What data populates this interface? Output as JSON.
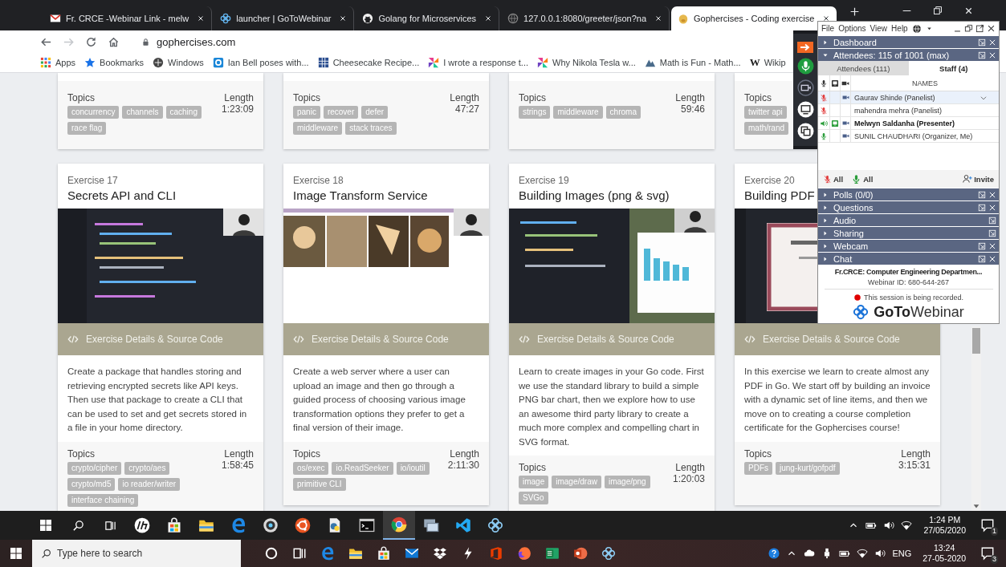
{
  "browser": {
    "tabs": [
      {
        "title": "Fr. CRCE -Webinar Link - melw",
        "kind": "mail",
        "selected": false
      },
      {
        "title": "launcher | GoToWebinar",
        "kind": "flower",
        "selected": false
      },
      {
        "title": "Golang for Microservices",
        "kind": "octo",
        "selected": false
      },
      {
        "title": "127.0.0.1:8080/greeter/json?na",
        "kind": "globe",
        "selected": false
      },
      {
        "title": "Gophercises - Coding exercise",
        "kind": "blob",
        "selected": true
      }
    ],
    "address": {
      "url": "gophercises.com",
      "forward_disabled": true
    },
    "bookmarks": [
      {
        "label": "Apps",
        "kind": "apps"
      },
      {
        "label": "Bookmarks",
        "kind": "star"
      },
      {
        "label": "Windows",
        "kind": "round"
      },
      {
        "label": "Ian Bell poses with...",
        "kind": "square"
      },
      {
        "label": "Cheesecake Recipe...",
        "kind": "grid"
      },
      {
        "label": "I wrote a response t...",
        "kind": "pinwheel"
      },
      {
        "label": "Why Nikola Tesla w...",
        "kind": "pinwheel"
      },
      {
        "label": "Math is Fun - Math...",
        "kind": "peak"
      },
      {
        "label": "Wikip",
        "kind": "letter",
        "letter": "W"
      }
    ]
  },
  "content": {
    "top_cards": [
      {
        "topics_label": "Topics",
        "tags": [
          "concurrency",
          "channels",
          "caching",
          "race flag"
        ],
        "length_label": "Length",
        "length": "1:23:09"
      },
      {
        "topics_label": "Topics",
        "tags": [
          "panic",
          "recover",
          "defer",
          "middleware",
          "stack traces"
        ],
        "length_label": "Length",
        "length": "47:27"
      },
      {
        "topics_label": "Topics",
        "tags": [
          "strings",
          "middleware",
          "chroma"
        ],
        "length_label": "Length",
        "length": "59:46"
      },
      {
        "topics_label": "Topics",
        "tags": [
          "twitter api",
          "math/rand"
        ]
      }
    ],
    "cards": [
      {
        "exercise": "Exercise 17",
        "title": "Secrets API and CLI",
        "link": "Exercise Details & Source Code",
        "description": "Create a package that handles storing and retrieving encrypted secrets like API keys. Then use that package to create a CLI that can be used to set and get secrets stored in a file in your home directory.",
        "topics_label": "Topics",
        "tags": [
          "crypto/cipher",
          "crypto/aes",
          "crypto/md5",
          "io reader/writer",
          "interface chaining"
        ],
        "length_label": "Length",
        "length": "1:58:45"
      },
      {
        "exercise": "Exercise 18",
        "title": "Image Transform Service",
        "link": "Exercise Details & Source Code",
        "description": "Create a web server where a user can upload an image and then go through a guided process of choosing various image transformation options they prefer to get a final version of their image.",
        "topics_label": "Topics",
        "tags": [
          "os/exec",
          "io.ReadSeeker",
          "io/ioutil",
          "primitive CLI"
        ],
        "length_label": "Length",
        "length": "2:11:30"
      },
      {
        "exercise": "Exercise 19",
        "title": "Building Images (png & svg)",
        "link": "Exercise Details & Source Code",
        "description": "Learn to create images in your Go code. First we use the standard library to build a simple PNG bar chart, then we explore how to use an awesome third party library to create a much more complex and compelling chart in SVG format.",
        "topics_label": "Topics",
        "tags": [
          "image",
          "image/draw",
          "image/png",
          "SVGo"
        ],
        "length_label": "Length",
        "length": "1:20:03"
      },
      {
        "exercise": "Exercise 20",
        "title": "Building PDF",
        "link": "Exercise Details & Source Code",
        "description": "In this exercise we learn to create almost any PDF in Go. We start off by building an invoice with a dynamic set of line items, and then we move on to creating a course completion certificate for the Gophercises course!",
        "topics_label": "Topics",
        "tags": [
          "PDFs",
          "jung-kurt/gofpdf"
        ],
        "length_label": "Length",
        "length": "3:15:31"
      }
    ]
  },
  "webinar": {
    "menu": [
      "File",
      "Options",
      "View",
      "Help"
    ],
    "sections": [
      {
        "title": "Dashboard",
        "expanded": false,
        "closable": true
      },
      {
        "title": "Attendees: 115 of 1001 (max)",
        "expanded": true,
        "closable": true,
        "kind": "attendees"
      },
      {
        "title": "Polls (0/0)",
        "expanded": false,
        "closable": true
      },
      {
        "title": "Questions",
        "expanded": false,
        "closable": true
      },
      {
        "title": "Audio",
        "expanded": false,
        "closable": false
      },
      {
        "title": "Sharing",
        "expanded": false,
        "closable": false
      },
      {
        "title": "Webcam",
        "expanded": false,
        "closable": true
      },
      {
        "title": "Chat",
        "expanded": false,
        "closable": true
      }
    ],
    "attendee_tabs": [
      {
        "label": "Attendees (111)",
        "selected": false
      },
      {
        "label": "Staff (4)",
        "selected": true
      }
    ],
    "names_header": "NAMES",
    "people": [
      {
        "name": "Gaurav Shinde (Panelist)",
        "kind": "muted",
        "presenter": false,
        "camera": true,
        "selected": true
      },
      {
        "name": "mahendra mehra (Panelist)",
        "kind": "muted",
        "presenter": false,
        "camera": false,
        "selected": false
      },
      {
        "name": "Melwyn Saldanha (Presenter)",
        "kind": "speaking",
        "presenter": true,
        "camera": true,
        "selected": false
      },
      {
        "name": "SUNIL CHAUDHARI (Organizer, Me)",
        "kind": "unmuted",
        "presenter": false,
        "camera": true,
        "selected": false
      }
    ],
    "mute_all": "All",
    "unmute_all": "All",
    "invite": "Invite",
    "organizer": "Fr.CRCE: Computer Engineering Departmen...",
    "webinar_id": "Webinar ID: 680-644-267",
    "recording": "This session is being recorded.",
    "logo_bold": "GoTo",
    "logo_light": "Webinar"
  },
  "taskbar_inner": {
    "apps": [
      {
        "kind": "hp",
        "active": false
      },
      {
        "kind": "bag",
        "active": false
      },
      {
        "kind": "folder",
        "active": false
      },
      {
        "kind": "edge",
        "active": false
      },
      {
        "kind": "webcam",
        "active": false
      },
      {
        "kind": "ring",
        "active": false
      },
      {
        "kind": "doc",
        "active": false
      },
      {
        "kind": "terminal",
        "active": false
      },
      {
        "kind": "chrome",
        "active": true
      },
      {
        "kind": "monitor",
        "active": false
      },
      {
        "kind": "ribbon",
        "active": false
      },
      {
        "kind": "flower",
        "active": false
      }
    ],
    "time": "1:24 PM",
    "date": "27/05/2020",
    "notifications": "1"
  },
  "taskbar_outer": {
    "search_placeholder": "Type here to search",
    "apps": [
      {
        "kind": "cortana"
      },
      {
        "kind": "taskview"
      },
      {
        "kind": "edge"
      },
      {
        "kind": "folder"
      },
      {
        "kind": "bag"
      },
      {
        "kind": "mail"
      },
      {
        "kind": "dropbox"
      },
      {
        "kind": "bolt"
      },
      {
        "kind": "office"
      },
      {
        "kind": "fox"
      },
      {
        "kind": "sheet"
      },
      {
        "kind": "slides"
      },
      {
        "kind": "flower"
      }
    ],
    "language": "ENG",
    "time": "13:24",
    "date": "27-05-2020",
    "notifications": "3"
  }
}
